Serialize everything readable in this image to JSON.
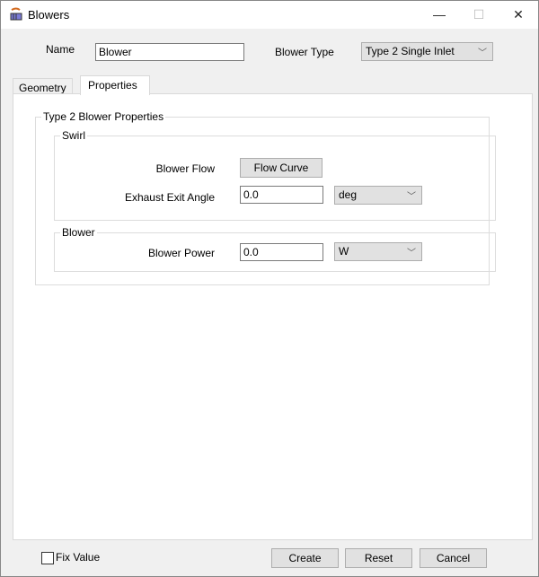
{
  "window": {
    "title": "Blowers",
    "minimize": "—",
    "maximize": "☐",
    "close": "✕"
  },
  "header": {
    "name_label": "Name",
    "name_value": "Blower",
    "type_label": "Blower Type",
    "type_value": "Type 2 Single Inlet"
  },
  "tabs": [
    {
      "label": "Geometry"
    },
    {
      "label": "Properties"
    }
  ],
  "properties": {
    "group_title": "Type 2 Blower Properties",
    "swirl": {
      "title": "Swirl",
      "flow_label": "Blower Flow",
      "flow_button": "Flow Curve",
      "angle_label": "Exhaust Exit Angle",
      "angle_value": "0.0",
      "angle_unit": "deg"
    },
    "blower": {
      "title": "Blower",
      "power_label": "Blower Power",
      "power_value": "0.0",
      "power_unit": "W"
    }
  },
  "footer": {
    "fix_value": "Fix Value",
    "create": "Create",
    "reset": "Reset",
    "cancel": "Cancel"
  }
}
